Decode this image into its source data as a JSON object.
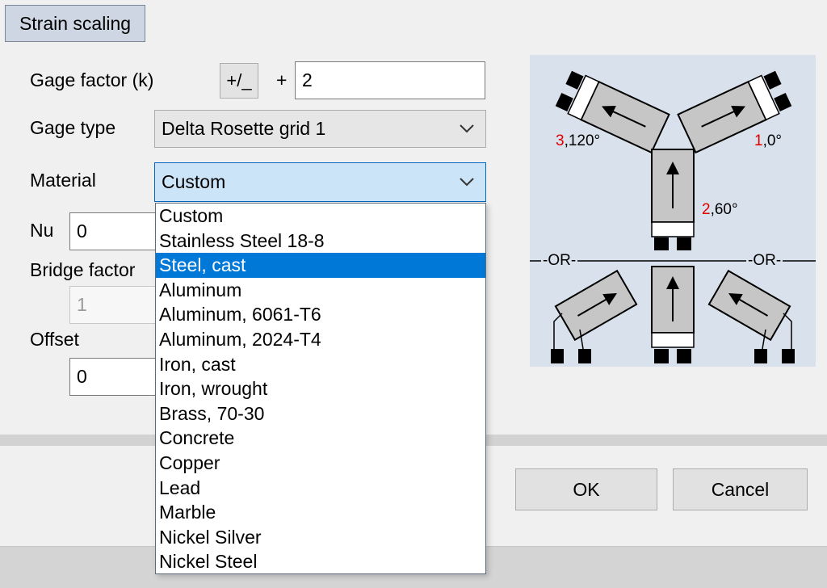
{
  "tab": {
    "label": "Strain scaling"
  },
  "gage_factor": {
    "label": "Gage factor (k)",
    "toggle_label": "+/_",
    "sign": "+",
    "value": "2"
  },
  "gage_type": {
    "label": "Gage type",
    "value": "Delta Rosette grid 1"
  },
  "material": {
    "label": "Material",
    "value": "Custom",
    "options": [
      "Custom",
      "Stainless Steel 18-8",
      "Steel, cast",
      "Aluminum",
      "Aluminum, 6061-T6",
      "Aluminum, 2024-T4",
      "Iron, cast",
      "Iron, wrought",
      "Brass, 70-30",
      "Concrete",
      "Copper",
      "Lead",
      "Marble",
      "Nickel Silver",
      "Nickel Steel"
    ],
    "selected_index": 2
  },
  "nu": {
    "label": "Nu",
    "value": "0"
  },
  "bridge_factor": {
    "label": "Bridge factor",
    "value": "1"
  },
  "offset": {
    "label": "Offset",
    "value": "0"
  },
  "diagram": {
    "gauge3": {
      "num": "3",
      "angle": ",120°"
    },
    "gauge1": {
      "num": "1",
      "angle": ",0°"
    },
    "gauge2": {
      "num": "2",
      "angle": ",60°"
    },
    "or_left": "-OR-",
    "or_right": "-OR-"
  },
  "buttons": {
    "ok": "OK",
    "cancel": "Cancel"
  },
  "colors": {
    "selection": "#0078d7",
    "label_red": "#e00000",
    "diagram_bg": "#d9e1ec"
  }
}
